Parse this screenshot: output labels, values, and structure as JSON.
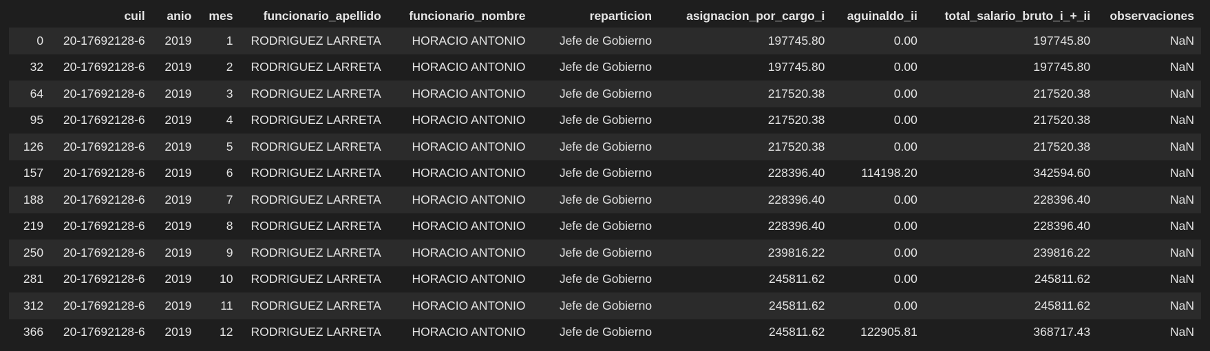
{
  "dataframe": {
    "columns": [
      "",
      "cuil",
      "anio",
      "mes",
      "funcionario_apellido",
      "funcionario_nombre",
      "reparticion",
      "asignacion_por_cargo_i",
      "aguinaldo_ii",
      "total_salario_bruto_i_+_ii",
      "observaciones"
    ],
    "rows": [
      [
        "0",
        "20-17692128-6",
        "2019",
        "1",
        "RODRIGUEZ LARRETA",
        "HORACIO ANTONIO",
        "Jefe de Gobierno",
        "197745.80",
        "0.00",
        "197745.80",
        "NaN"
      ],
      [
        "32",
        "20-17692128-6",
        "2019",
        "2",
        "RODRIGUEZ LARRETA",
        "HORACIO ANTONIO",
        "Jefe de Gobierno",
        "197745.80",
        "0.00",
        "197745.80",
        "NaN"
      ],
      [
        "64",
        "20-17692128-6",
        "2019",
        "3",
        "RODRIGUEZ LARRETA",
        "HORACIO ANTONIO",
        "Jefe de Gobierno",
        "217520.38",
        "0.00",
        "217520.38",
        "NaN"
      ],
      [
        "95",
        "20-17692128-6",
        "2019",
        "4",
        "RODRIGUEZ LARRETA",
        "HORACIO ANTONIO",
        "Jefe de Gobierno",
        "217520.38",
        "0.00",
        "217520.38",
        "NaN"
      ],
      [
        "126",
        "20-17692128-6",
        "2019",
        "5",
        "RODRIGUEZ LARRETA",
        "HORACIO ANTONIO",
        "Jefe de Gobierno",
        "217520.38",
        "0.00",
        "217520.38",
        "NaN"
      ],
      [
        "157",
        "20-17692128-6",
        "2019",
        "6",
        "RODRIGUEZ LARRETA",
        "HORACIO ANTONIO",
        "Jefe de Gobierno",
        "228396.40",
        "114198.20",
        "342594.60",
        "NaN"
      ],
      [
        "188",
        "20-17692128-6",
        "2019",
        "7",
        "RODRIGUEZ LARRETA",
        "HORACIO ANTONIO",
        "Jefe de Gobierno",
        "228396.40",
        "0.00",
        "228396.40",
        "NaN"
      ],
      [
        "219",
        "20-17692128-6",
        "2019",
        "8",
        "RODRIGUEZ LARRETA",
        "HORACIO ANTONIO",
        "Jefe de Gobierno",
        "228396.40",
        "0.00",
        "228396.40",
        "NaN"
      ],
      [
        "250",
        "20-17692128-6",
        "2019",
        "9",
        "RODRIGUEZ LARRETA",
        "HORACIO ANTONIO",
        "Jefe de Gobierno",
        "239816.22",
        "0.00",
        "239816.22",
        "NaN"
      ],
      [
        "281",
        "20-17692128-6",
        "2019",
        "10",
        "RODRIGUEZ LARRETA",
        "HORACIO ANTONIO",
        "Jefe de Gobierno",
        "245811.62",
        "0.00",
        "245811.62",
        "NaN"
      ],
      [
        "312",
        "20-17692128-6",
        "2019",
        "11",
        "RODRIGUEZ LARRETA",
        "HORACIO ANTONIO",
        "Jefe de Gobierno",
        "245811.62",
        "0.00",
        "245811.62",
        "NaN"
      ],
      [
        "366",
        "20-17692128-6",
        "2019",
        "12",
        "RODRIGUEZ LARRETA",
        "HORACIO ANTONIO",
        "Jefe de Gobierno",
        "245811.62",
        "122905.81",
        "368717.43",
        "NaN"
      ]
    ]
  },
  "colors": {
    "background": "#1e1e1e",
    "row_stripe": "#2b2b2b",
    "text": "#e2e2e2"
  }
}
